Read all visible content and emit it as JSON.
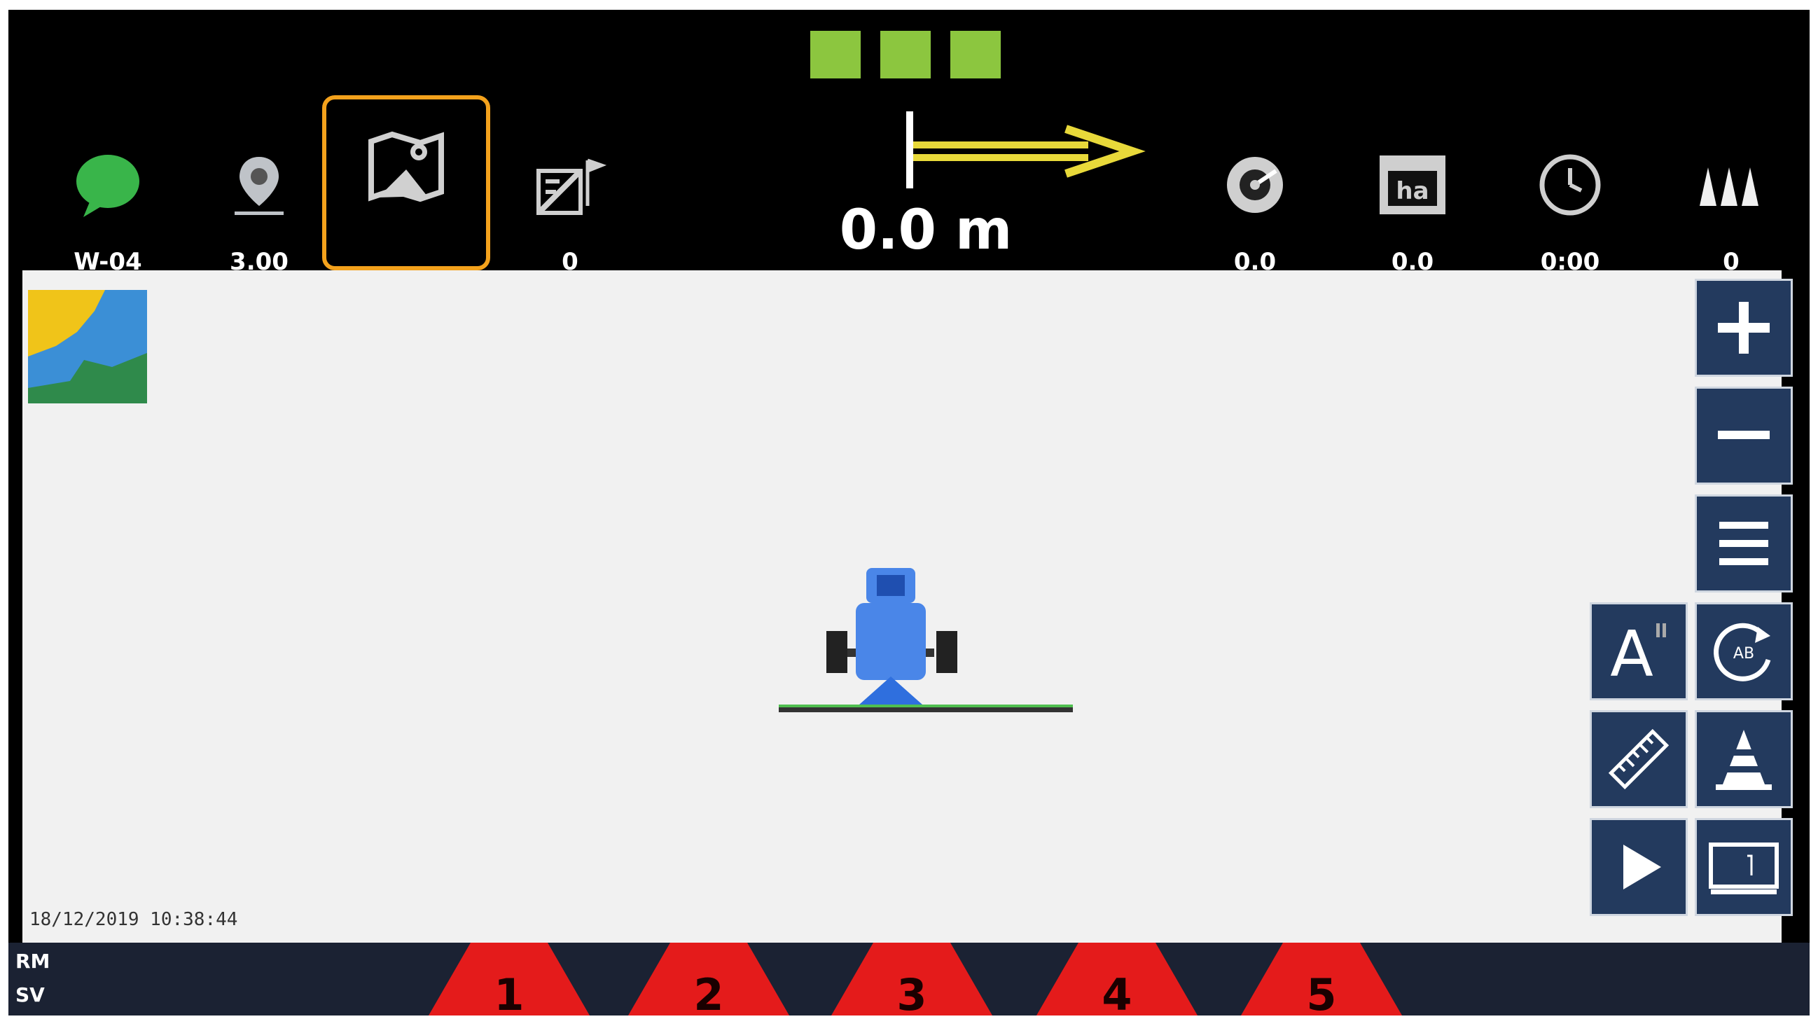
{
  "status_squares": [
    "#8cc63f",
    "#8cc63f",
    "#8cc63f"
  ],
  "topbar": {
    "left_items": [
      {
        "icon": "chat-bubble-icon",
        "label": "W-04"
      },
      {
        "icon": "location-pin-icon",
        "label": "3.00"
      },
      {
        "icon": "field-map-icon",
        "label": ""
      },
      {
        "icon": "field-flags-icon",
        "label": "0"
      }
    ],
    "distance": "0.0 m",
    "right_items": [
      {
        "icon": "speedometer-icon",
        "label": "0.0"
      },
      {
        "icon": "hectare-icon",
        "label": "0.0",
        "icon_text": "ha"
      },
      {
        "icon": "clock-icon",
        "label": "0:00"
      },
      {
        "icon": "nozzles-icon",
        "label": "0"
      }
    ]
  },
  "map": {
    "datetime": "18/12/2019 10:38:44"
  },
  "right_buttons": [
    "zoom-in-icon",
    "zoom-out-icon",
    "menu-icon",
    "auto-text-icon",
    "rotate-ab-icon",
    "ruler-icon",
    "cone-icon",
    "play-icon",
    "screen-icon"
  ],
  "bottom": {
    "line1": "RM",
    "line2": "SV",
    "sections": [
      "1",
      "2",
      "3",
      "4",
      "5"
    ],
    "section_color": "#e41b1b"
  }
}
